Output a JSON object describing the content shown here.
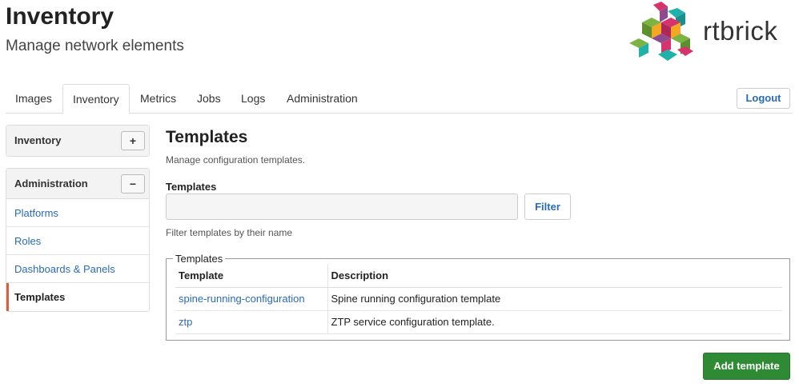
{
  "header": {
    "title": "Inventory",
    "subtitle": "Manage network elements",
    "logo_text": "rtbrick"
  },
  "tabs": [
    {
      "label": "Images",
      "active": false
    },
    {
      "label": "Inventory",
      "active": true
    },
    {
      "label": "Metrics",
      "active": false
    },
    {
      "label": "Jobs",
      "active": false
    },
    {
      "label": "Logs",
      "active": false
    },
    {
      "label": "Administration",
      "active": false
    }
  ],
  "logout_label": "Logout",
  "sidebar": {
    "inventory_panel": {
      "title": "Inventory",
      "toggle": "+"
    },
    "admin_panel": {
      "title": "Administration",
      "toggle": "−",
      "items": [
        {
          "label": "Platforms",
          "active": false
        },
        {
          "label": "Roles",
          "active": false
        },
        {
          "label": "Dashboards & Panels",
          "active": false
        },
        {
          "label": "Templates",
          "active": true
        }
      ]
    }
  },
  "main": {
    "title": "Templates",
    "description": "Manage configuration templates.",
    "filter_label": "Templates",
    "filter_value": "",
    "filter_placeholder": "",
    "filter_button": "Filter",
    "filter_help": "Filter templates by their name",
    "table": {
      "legend": "Templates",
      "columns": [
        "Template",
        "Description"
      ],
      "rows": [
        {
          "template": "spine-running-configuration",
          "description": "Spine running configuration template"
        },
        {
          "template": "ztp",
          "description": "ZTP service configuration template."
        }
      ]
    },
    "add_button": "Add template"
  },
  "colors": {
    "link": "#2a6bb5",
    "active_marker": "#d9603a",
    "primary_button": "#2f8a34",
    "logo_pink": "#d6336c",
    "logo_teal": "#20b2aa",
    "logo_green": "#7cb342",
    "logo_orange": "#f5a623",
    "logo_purple": "#8e4a8e"
  }
}
